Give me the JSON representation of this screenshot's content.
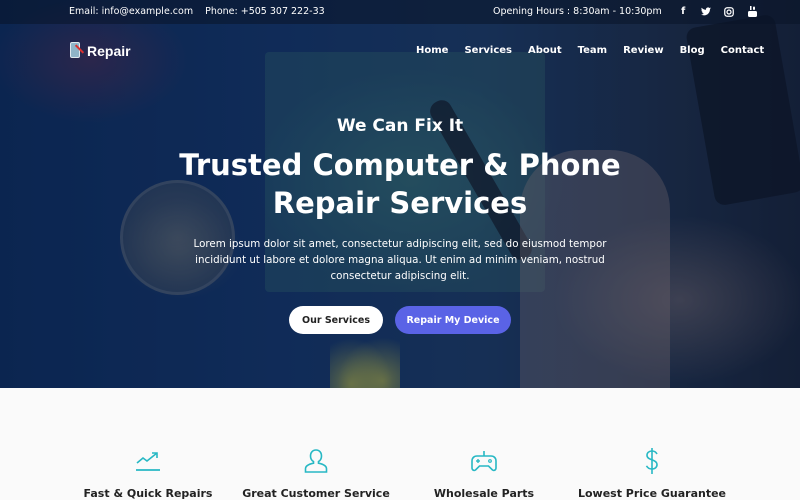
{
  "topbar": {
    "email": "Email: info@example.com",
    "phone": "Phone: +505 307 222-33",
    "hours": "Opening Hours : 8:30am - 10:30pm",
    "social": [
      "facebook-icon",
      "twitter-icon",
      "instagram-icon",
      "youtube-icon"
    ]
  },
  "brand": {
    "name": "Repair"
  },
  "nav": [
    "Home",
    "Services",
    "About",
    "Team",
    "Review",
    "Blog",
    "Contact"
  ],
  "hero": {
    "kicker": "We Can Fix It",
    "headline_line1": "Trusted Computer & Phone",
    "headline_line2": "Repair Services",
    "description": "Lorem ipsum dolor sit amet, consectetur adipiscing elit, sed do eiusmod tempor incididunt ut labore et dolore magna aliqua. Ut enim ad minim veniam, nostrud consectetur adipiscing elit.",
    "button_secondary": "Our Services",
    "button_primary": "Repair My Device"
  },
  "features": [
    {
      "icon": "trending-up-icon",
      "title": "Fast & Quick Repairs"
    },
    {
      "icon": "user-icon",
      "title": "Great Customer Service"
    },
    {
      "icon": "gamepad-icon",
      "title": "Wholesale Parts"
    },
    {
      "icon": "dollar-icon",
      "title": "Lowest Price Guarantee"
    }
  ],
  "colors": {
    "primary": "#5a63e6",
    "accent": "#27b8c4",
    "hero_overlay": "#0d2a57"
  }
}
